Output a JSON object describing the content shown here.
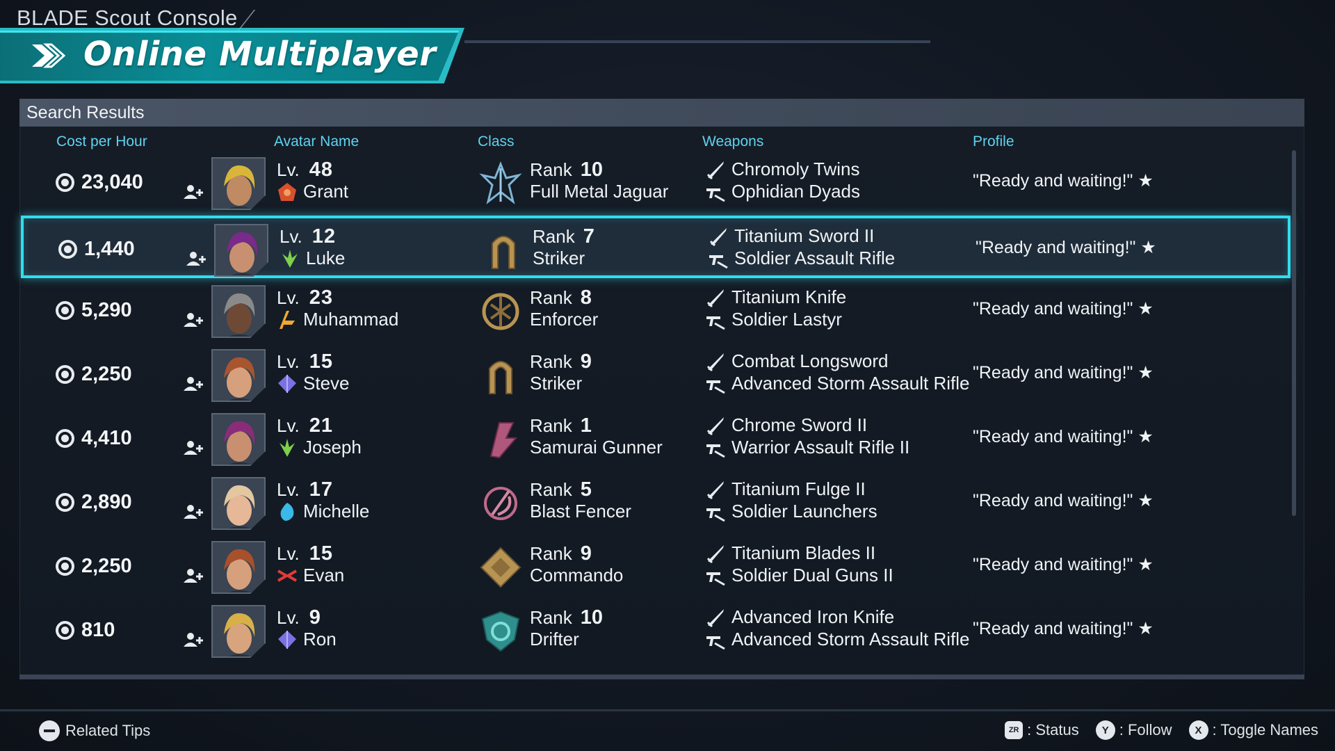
{
  "app": {
    "console_title": "BLADE Scout Console",
    "screen_title": "Online Multiplayer",
    "panel_title": "Search Results"
  },
  "columns": {
    "cost": "Cost per Hour",
    "avatar": "Avatar Name",
    "class": "Class",
    "weapons": "Weapons",
    "profile": "Profile"
  },
  "selected_index": 1,
  "rows": [
    {
      "cost": "23,040",
      "level_label": "Lv.",
      "level": "48",
      "name": "Grant",
      "element": "fire-element-icon",
      "rank_label": "Rank",
      "rank": "10",
      "class": "Full Metal Jaguar",
      "weapon1": "Chromoly Twins",
      "weapon2": "Ophidian Dyads",
      "profile": "\"Ready and waiting!\" ★",
      "hair": "#d9b63a",
      "skin": "#c08a63"
    },
    {
      "cost": "1,440",
      "level_label": "Lv.",
      "level": "12",
      "name": "Luke",
      "element": "nature-element-icon",
      "rank_label": "Rank",
      "rank": "7",
      "class": "Striker",
      "weapon1": "Titanium Sword II",
      "weapon2": "Soldier Assault Rifle",
      "profile": "\"Ready and waiting!\" ★",
      "hair": "#7a2a8a",
      "skin": "#c89070"
    },
    {
      "cost": "5,290",
      "level_label": "Lv.",
      "level": "23",
      "name": "Muhammad",
      "element": "beam-element-icon",
      "rank_label": "Rank",
      "rank": "8",
      "class": "Enforcer",
      "weapon1": "Titanium Knife",
      "weapon2": "Soldier Lastyr",
      "profile": "\"Ready and waiting!\" ★",
      "hair": "#8a8a8a",
      "skin": "#6e4a36"
    },
    {
      "cost": "2,250",
      "level_label": "Lv.",
      "level": "15",
      "name": "Steve",
      "element": "crystal-element-icon",
      "rank_label": "Rank",
      "rank": "9",
      "class": "Striker",
      "weapon1": "Combat Longsword",
      "weapon2": "Advanced Storm Assault Rifle",
      "profile": "\"Ready and waiting!\" ★",
      "hair": "#a85530",
      "skin": "#d6a07c"
    },
    {
      "cost": "4,410",
      "level_label": "Lv.",
      "level": "21",
      "name": "Joseph",
      "element": "nature-element-icon",
      "rank_label": "Rank",
      "rank": "1",
      "class": "Samurai Gunner",
      "weapon1": "Chrome Sword II",
      "weapon2": "Warrior Assault Rifle II",
      "profile": "\"Ready and waiting!\" ★",
      "hair": "#8a2c7a",
      "skin": "#c89070"
    },
    {
      "cost": "2,890",
      "level_label": "Lv.",
      "level": "17",
      "name": "Michelle",
      "element": "ice-element-icon",
      "rank_label": "Rank",
      "rank": "5",
      "class": "Blast Fencer",
      "weapon1": "Titanium Fulge II",
      "weapon2": "Soldier Launchers",
      "profile": "\"Ready and waiting!\" ★",
      "hair": "#e3c7a0",
      "skin": "#e6b898"
    },
    {
      "cost": "2,250",
      "level_label": "Lv.",
      "level": "15",
      "name": "Evan",
      "element": "electric-element-icon",
      "rank_label": "Rank",
      "rank": "9",
      "class": "Commando",
      "weapon1": "Titanium Blades II",
      "weapon2": "Soldier Dual Guns II",
      "profile": "\"Ready and waiting!\" ★",
      "hair": "#a8502c",
      "skin": "#d6a07c"
    },
    {
      "cost": "810",
      "level_label": "Lv.",
      "level": "9",
      "name": "Ron",
      "element": "crystal-element-icon",
      "rank_label": "Rank",
      "rank": "10",
      "class": "Drifter",
      "weapon1": "Advanced Iron Knife",
      "weapon2": "Advanced Storm Assault Rifle",
      "profile": "\"Ready and waiting!\" ★",
      "hair": "#d8b048",
      "skin": "#d8a47e"
    }
  ],
  "footer": {
    "tips": "Related Tips",
    "zr_key": "ZR",
    "zr_label": ": Status",
    "y_key": "Y",
    "y_label": ": Follow",
    "x_key": "X",
    "x_label": ": Toggle Names"
  },
  "colors": {
    "accent": "#33dced",
    "banner": "#0a8d96",
    "column_header": "#5fd3f0"
  }
}
